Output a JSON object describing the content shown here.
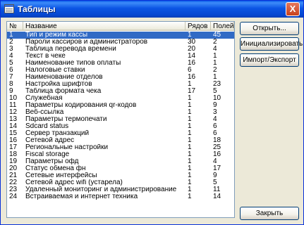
{
  "window": {
    "title": "Таблицы",
    "close_glyph": "X"
  },
  "columns": [
    "№",
    "Название",
    "Рядов",
    "Полей"
  ],
  "rows": [
    [
      "1",
      "Тип и режим кассы",
      "1",
      "45"
    ],
    [
      "2",
      "Пароли кассиров и администраторов",
      "30",
      "2"
    ],
    [
      "3",
      "Таблица перевода времени",
      "20",
      "4"
    ],
    [
      "4",
      "Текст в чеке",
      "14",
      "1"
    ],
    [
      "5",
      "Наименование типов оплаты",
      "16",
      "1"
    ],
    [
      "6",
      "Налоговые ставки",
      "6",
      "2"
    ],
    [
      "7",
      "Наименование отделов",
      "16",
      "1"
    ],
    [
      "8",
      "Настройка шрифтов",
      "1",
      "23"
    ],
    [
      "9",
      "Таблица формата чека",
      "17",
      "5"
    ],
    [
      "10",
      "Служебная",
      "1",
      "10"
    ],
    [
      "11",
      "Параметры кодирования qr-кодов",
      "1",
      "9"
    ],
    [
      "12",
      "Веб-ссылка",
      "1",
      "3"
    ],
    [
      "13",
      "Параметры термопечати",
      "1",
      "4"
    ],
    [
      "14",
      "Sdcard status",
      "1",
      "6"
    ],
    [
      "15",
      "Сервер транзакций",
      "1",
      "6"
    ],
    [
      "16",
      "Сетевой адрес",
      "1",
      "18"
    ],
    [
      "17",
      "Региональные настройки",
      "1",
      "25"
    ],
    [
      "18",
      "Fiscal storage",
      "1",
      "16"
    ],
    [
      "19",
      "Параметры офд",
      "1",
      "4"
    ],
    [
      "20",
      "Статус обмена фн",
      "1",
      "17"
    ],
    [
      "21",
      "Сетевые интерфейсы",
      "1",
      "9"
    ],
    [
      "22",
      "Сетевой адрес wifi (устарела)",
      "1",
      "5"
    ],
    [
      "23",
      "Удаленный мониторинг и администрирование",
      "1",
      "11"
    ],
    [
      "24",
      "Встраиваемая и интернет техника",
      "1",
      "14"
    ]
  ],
  "selected_row": 0,
  "buttons": {
    "open": "Открыть...",
    "init": "Инициализировать",
    "import_export": "Импорт/Экспорт",
    "close": "Закрыть"
  }
}
